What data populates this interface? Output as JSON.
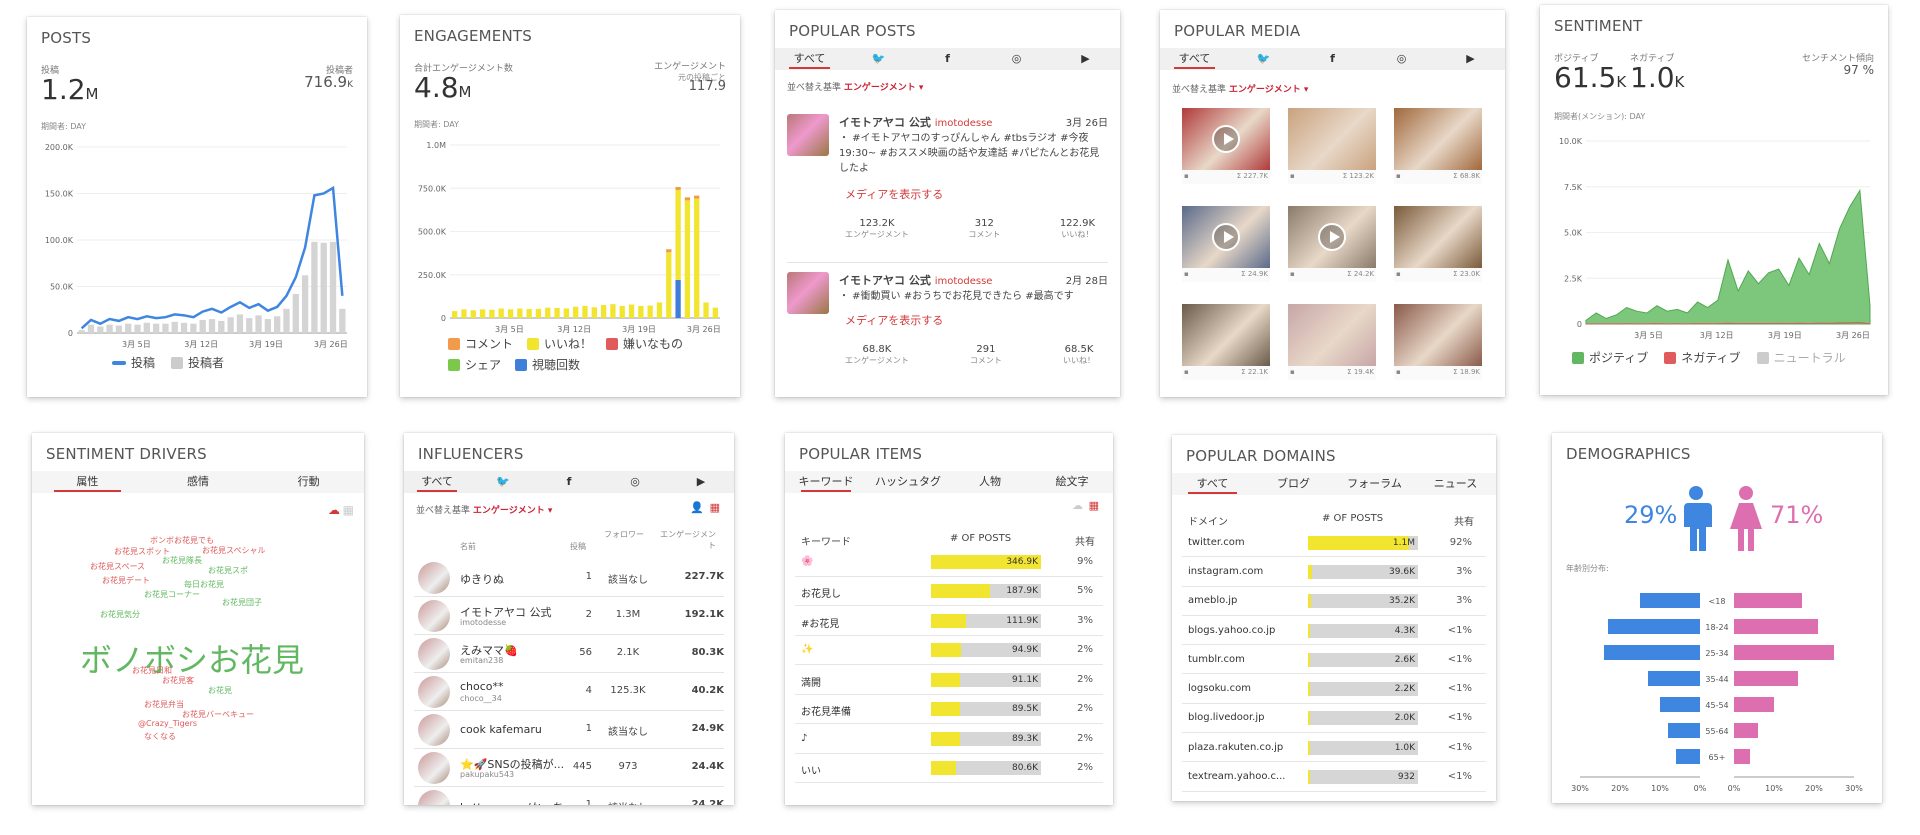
{
  "posts": {
    "title": "POSTS",
    "metric1_label": "投稿",
    "metric1_value": "1.2",
    "metric1_unit": "M",
    "metric2_label": "投稿者",
    "metric2_value": "716.9",
    "metric2_unit": "K",
    "sub_label": "期間者: DAY",
    "legend": [
      {
        "label": "投稿",
        "color": "#3f86e0"
      },
      {
        "label": "投稿者",
        "color": "#cccccc"
      }
    ]
  },
  "engagements": {
    "title": "ENGAGEMENTS",
    "metric1_label": "合計エンゲージメント数",
    "metric1_value": "4.8",
    "metric1_unit": "M",
    "metric2_label": "エンゲージメント",
    "metric2_label2": "元の投稿ごと",
    "metric2_value": "117.9",
    "sub_label": "期間者: DAY",
    "legend": [
      {
        "label": "コメント",
        "color": "#f29a4a"
      },
      {
        "label": "いいね！",
        "color": "#f2e530"
      },
      {
        "label": "嫌いなもの",
        "color": "#e05b5b"
      },
      {
        "label": "シェア",
        "color": "#7bc84a"
      },
      {
        "label": "視聴回数",
        "color": "#3f7fd9"
      }
    ]
  },
  "popular_posts": {
    "title": "POPULAR POSTS",
    "tabs": [
      "すべて",
      "twitter",
      "facebook",
      "instagram",
      "youtube"
    ],
    "sort_label": "並べ替え基準",
    "sort_value": "エンゲージメント ▾",
    "items": [
      {
        "author": "イモトアヤコ 公式",
        "handle": "imotodesse",
        "date": "3月 26日",
        "text": "・ #イモトアヤコのすっぴんしゃん #tbsラジオ #今夜19:30~ #おススメ映画の話や友達話 #パピたんとお花見したよ",
        "media_link": "メディアを表示する",
        "stats": [
          {
            "value": "123.2K",
            "label": "エンゲージメント"
          },
          {
            "value": "312",
            "label": "コメント"
          },
          {
            "value": "122.9K",
            "label": "いいね！"
          }
        ]
      },
      {
        "author": "イモトアヤコ 公式",
        "handle": "imotodesse",
        "date": "2月 28日",
        "text": "・ #衝動買い #おうちでお花見できたら #最高です",
        "media_link": "メディアを表示する",
        "stats": [
          {
            "value": "68.8K",
            "label": "エンゲージメント"
          },
          {
            "value": "291",
            "label": "コメント"
          },
          {
            "value": "68.5K",
            "label": "いいね！"
          }
        ]
      }
    ]
  },
  "popular_media": {
    "title": "POPULAR MEDIA",
    "tabs": [
      "すべて",
      "twitter",
      "facebook",
      "instagram",
      "youtube"
    ],
    "sort_label": "並べ替え基準",
    "sort_value": "エンゲージメント ▾",
    "items": [
      {
        "value": "227.7K",
        "video": true,
        "color": "#b03a3a"
      },
      {
        "value": "123.2K",
        "video": false,
        "color": "#c9a27e"
      },
      {
        "value": "68.8K",
        "video": false,
        "color": "#a0683c"
      },
      {
        "value": "24.9K",
        "video": true,
        "color": "#5a6a8a"
      },
      {
        "value": "24.2K",
        "video": true,
        "color": "#8a7a6a"
      },
      {
        "value": "23.0K",
        "video": false,
        "color": "#7a5a3a"
      },
      {
        "value": "22.1K",
        "video": false,
        "color": "#6a5a4a"
      },
      {
        "value": "19.4K",
        "video": false,
        "color": "#c7a6a8"
      },
      {
        "value": "18.9K",
        "video": false,
        "color": "#8a5a4a"
      }
    ]
  },
  "sentiment": {
    "title": "SENTIMENT",
    "pos_label": "ポジティブ",
    "pos_value": "61.5",
    "pos_unit": "K",
    "neg_label": "ネガティブ",
    "neg_value": "1.0",
    "neg_unit": "K",
    "trend_label": "センチメント傾向",
    "trend_value": "97 %",
    "sub_label": "期間者(メンション): DAY",
    "legend": [
      {
        "label": "ポジティブ",
        "color": "#62b862"
      },
      {
        "label": "ネガティブ",
        "color": "#e05b5b"
      },
      {
        "label": "ニュートラル",
        "color": "#cccccc"
      }
    ]
  },
  "sentiment_drivers": {
    "title": "SENTIMENT DRIVERS",
    "tabs": [
      "属性",
      "感情",
      "行動"
    ],
    "main_word": "ボノボシお花見",
    "words": [
      {
        "text": "ボンボお花見でも",
        "color": "#e05b5b"
      },
      {
        "text": "お花見スペシャル",
        "color": "#e05b5b"
      },
      {
        "text": "お花見スポット",
        "color": "#e05b5b"
      },
      {
        "text": "お花見隊長",
        "color": "#62b862"
      },
      {
        "text": "お花見スポ",
        "color": "#62b862"
      },
      {
        "text": "お花見スペース",
        "color": "#e05b5b"
      },
      {
        "text": "お花見デート",
        "color": "#e05b5b"
      },
      {
        "text": "毎日お花見",
        "color": "#62b862"
      },
      {
        "text": "お花見コーナー",
        "color": "#62b862"
      },
      {
        "text": "お花見団子",
        "color": "#62b862"
      },
      {
        "text": "お花見気分",
        "color": "#62b862"
      },
      {
        "text": "お花見日和",
        "color": "#e05b5b"
      },
      {
        "text": "お花見客",
        "color": "#e05b5b"
      },
      {
        "text": "お花見弁当",
        "color": "#e05b5b"
      },
      {
        "text": "お花見バーベキュー",
        "color": "#e05b5b"
      },
      {
        "text": "@Crazy_Tigers",
        "color": "#e05b5b"
      },
      {
        "text": "なくなる",
        "color": "#e05b5b"
      },
      {
        "text": "お花見",
        "color": "#62b862"
      }
    ]
  },
  "influencers": {
    "title": "INFLUENCERS",
    "tabs": [
      "すべて",
      "twitter",
      "facebook",
      "instagram",
      "youtube"
    ],
    "sort_label": "並べ替え基準",
    "sort_value": "エンゲージメント ▾",
    "headers": [
      "名前",
      "投稿",
      "フォロワー",
      "エンゲージメント"
    ],
    "rows": [
      {
        "name": "ゆきりぬ",
        "handle": "",
        "posts": "1",
        "followers": "該当なし",
        "eng": "227.7K"
      },
      {
        "name": "イモトアヤコ 公式",
        "handle": "imotodesse",
        "posts": "2",
        "followers": "1.3M",
        "eng": "192.1K"
      },
      {
        "name": "えみママ🍓",
        "handle": "emitan238",
        "posts": "56",
        "followers": "2.1K",
        "eng": "80.3K"
      },
      {
        "name": "choco**",
        "handle": "choco__34",
        "posts": "4",
        "followers": "125.3K",
        "eng": "40.2K"
      },
      {
        "name": "cook kafemaru",
        "handle": "",
        "posts": "1",
        "followers": "該当なし",
        "eng": "24.9K"
      },
      {
        "name": "⭐🚀SNSの投稿が...",
        "handle": "pakupaku543",
        "posts": "445",
        "followers": "973",
        "eng": "24.4K"
      },
      {
        "name": "kattyanneru/かっち...",
        "handle": "",
        "posts": "1",
        "followers": "該当なし",
        "eng": "24.2K"
      }
    ]
  },
  "popular_items": {
    "title": "POPULAR ITEMS",
    "tabs": [
      "キーワード",
      "ハッシュタグ",
      "人物",
      "絵文字"
    ],
    "headers": [
      "キーワード",
      "# OF POSTS",
      "共有"
    ],
    "rows": [
      {
        "label": "🌸",
        "value": "346.9K",
        "share": "9%",
        "pct": 1.0
      },
      {
        "label": "お花見し",
        "value": "187.9K",
        "share": "5%",
        "pct": 0.54
      },
      {
        "label": "#お花見",
        "value": "111.9K",
        "share": "3%",
        "pct": 0.32
      },
      {
        "label": "✨",
        "value": "94.9K",
        "share": "2%",
        "pct": 0.27
      },
      {
        "label": "満開",
        "value": "91.1K",
        "share": "2%",
        "pct": 0.26
      },
      {
        "label": "お花見準備",
        "value": "89.5K",
        "share": "2%",
        "pct": 0.26
      },
      {
        "label": "♪",
        "value": "89.3K",
        "share": "2%",
        "pct": 0.26
      },
      {
        "label": "いい",
        "value": "80.6K",
        "share": "2%",
        "pct": 0.23
      }
    ]
  },
  "popular_domains": {
    "title": "POPULAR DOMAINS",
    "tabs": [
      "すべて",
      "ブログ",
      "フォーラム",
      "ニュース"
    ],
    "headers": [
      "ドメイン",
      "# OF POSTS",
      "共有"
    ],
    "rows": [
      {
        "label": "twitter.com",
        "value": "1.1M",
        "share": "92%",
        "pct": 0.92
      },
      {
        "label": "instagram.com",
        "value": "39.6K",
        "share": "3%",
        "pct": 0.035
      },
      {
        "label": "ameblo.jp",
        "value": "35.2K",
        "share": "3%",
        "pct": 0.031
      },
      {
        "label": "blogs.yahoo.co.jp",
        "value": "4.3K",
        "share": "<1%",
        "pct": 0.004
      },
      {
        "label": "tumblr.com",
        "value": "2.6K",
        "share": "<1%",
        "pct": 0.003
      },
      {
        "label": "logsoku.com",
        "value": "2.2K",
        "share": "<1%",
        "pct": 0.002
      },
      {
        "label": "blog.livedoor.jp",
        "value": "2.0K",
        "share": "<1%",
        "pct": 0.002
      },
      {
        "label": "plaza.rakuten.co.jp",
        "value": "1.0K",
        "share": "<1%",
        "pct": 0.001
      },
      {
        "label": "textream.yahoo.c...",
        "value": "932",
        "share": "<1%",
        "pct": 0.001
      }
    ]
  },
  "demographics": {
    "title": "DEMOGRAPHICS",
    "male_pct": "29%",
    "female_pct": "71%",
    "age_label": "年齢別分布:",
    "male_color": "#3f86e0",
    "female_color": "#dd6fb0"
  },
  "chart_data": [
    {
      "type": "line",
      "title": "POSTS",
      "x_ticks": [
        "3月 5日",
        "3月 12日",
        "3月 19日",
        "3月 26日"
      ],
      "y_ticks": [
        "0",
        "50.0K",
        "100.0K",
        "150.0K",
        "200.0K"
      ],
      "ylim": [
        0,
        200000
      ],
      "series": [
        {
          "name": "投稿",
          "type": "line",
          "values": [
            5000,
            14000,
            10000,
            15000,
            13000,
            17000,
            15000,
            18000,
            16000,
            17000,
            20000,
            19000,
            17000,
            23000,
            26000,
            22000,
            28000,
            33000,
            27000,
            31000,
            24000,
            28000,
            40000,
            60000,
            92000,
            148000,
            150000,
            156000,
            40000
          ]
        },
        {
          "name": "投稿者",
          "type": "bar",
          "values": [
            3000,
            9000,
            7000,
            9000,
            8000,
            10000,
            9000,
            11000,
            10000,
            10000,
            12000,
            11000,
            10000,
            14000,
            15000,
            13000,
            17000,
            20000,
            16000,
            19000,
            15000,
            18000,
            26000,
            42000,
            62000,
            98000,
            97000,
            98000,
            26000
          ]
        }
      ]
    },
    {
      "type": "bar",
      "title": "ENGAGEMENTS",
      "x_ticks": [
        "3月 5日",
        "3月 12日",
        "3月 19日",
        "3月 26日"
      ],
      "y_ticks": [
        "0",
        "250.0K",
        "500.0K",
        "750.0K",
        "1.0M"
      ],
      "ylim": [
        0,
        1000000
      ],
      "series": [
        {
          "name": "いいね！",
          "values": [
            40000,
            50000,
            45000,
            50000,
            48000,
            55000,
            50000,
            55000,
            52000,
            53000,
            60000,
            58000,
            55000,
            65000,
            70000,
            62000,
            75000,
            80000,
            70000,
            78000,
            70000,
            72000,
            90000,
            380000,
            520000,
            680000,
            690000,
            90000,
            60000
          ]
        },
        {
          "name": "視聴回数",
          "values": [
            0,
            0,
            0,
            0,
            0,
            0,
            0,
            0,
            0,
            0,
            0,
            0,
            0,
            0,
            0,
            0,
            0,
            0,
            0,
            0,
            0,
            0,
            0,
            0,
            220000,
            0,
            0,
            0,
            0
          ]
        }
      ]
    },
    {
      "type": "area",
      "title": "SENTIMENT",
      "x_ticks": [
        "3月 5日",
        "3月 12日",
        "3月 19日",
        "3月 26日"
      ],
      "y_ticks": [
        "0",
        "2.5K",
        "5.0K",
        "7.5K",
        "10.0K"
      ],
      "ylim": [
        0,
        10000
      ],
      "series": [
        {
          "name": "ポジティブ",
          "values": [
            200,
            600,
            300,
            500,
            900,
            700,
            600,
            1000,
            700,
            800,
            600,
            1200,
            900,
            1300,
            3500,
            1800,
            2900,
            2200,
            2800,
            3000,
            2100,
            3600,
            2700,
            4400,
            3300,
            5200,
            6400,
            7300,
            1000
          ]
        },
        {
          "name": "ネガティブ",
          "values": [
            0,
            10,
            5,
            10,
            15,
            10,
            10,
            20,
            10,
            15,
            10,
            20,
            15,
            20,
            40,
            25,
            30,
            25,
            30,
            35,
            25,
            40,
            30,
            50,
            40,
            60,
            70,
            80,
            15
          ]
        }
      ]
    },
    {
      "type": "bar",
      "title": "DEMOGRAPHICS",
      "categories": [
        "<18",
        "18-24",
        "25-34",
        "35-44",
        "45-54",
        "55-64",
        "65+"
      ],
      "x_ticks_left": [
        "30%",
        "20%",
        "10%",
        "0%"
      ],
      "x_ticks_right": [
        "0%",
        "10%",
        "20%",
        "30%"
      ],
      "series": [
        {
          "name": "male",
          "values": [
            15,
            23,
            24,
            13,
            10,
            8,
            6
          ]
        },
        {
          "name": "female",
          "values": [
            17,
            21,
            25,
            16,
            10,
            6,
            4
          ]
        }
      ]
    }
  ]
}
